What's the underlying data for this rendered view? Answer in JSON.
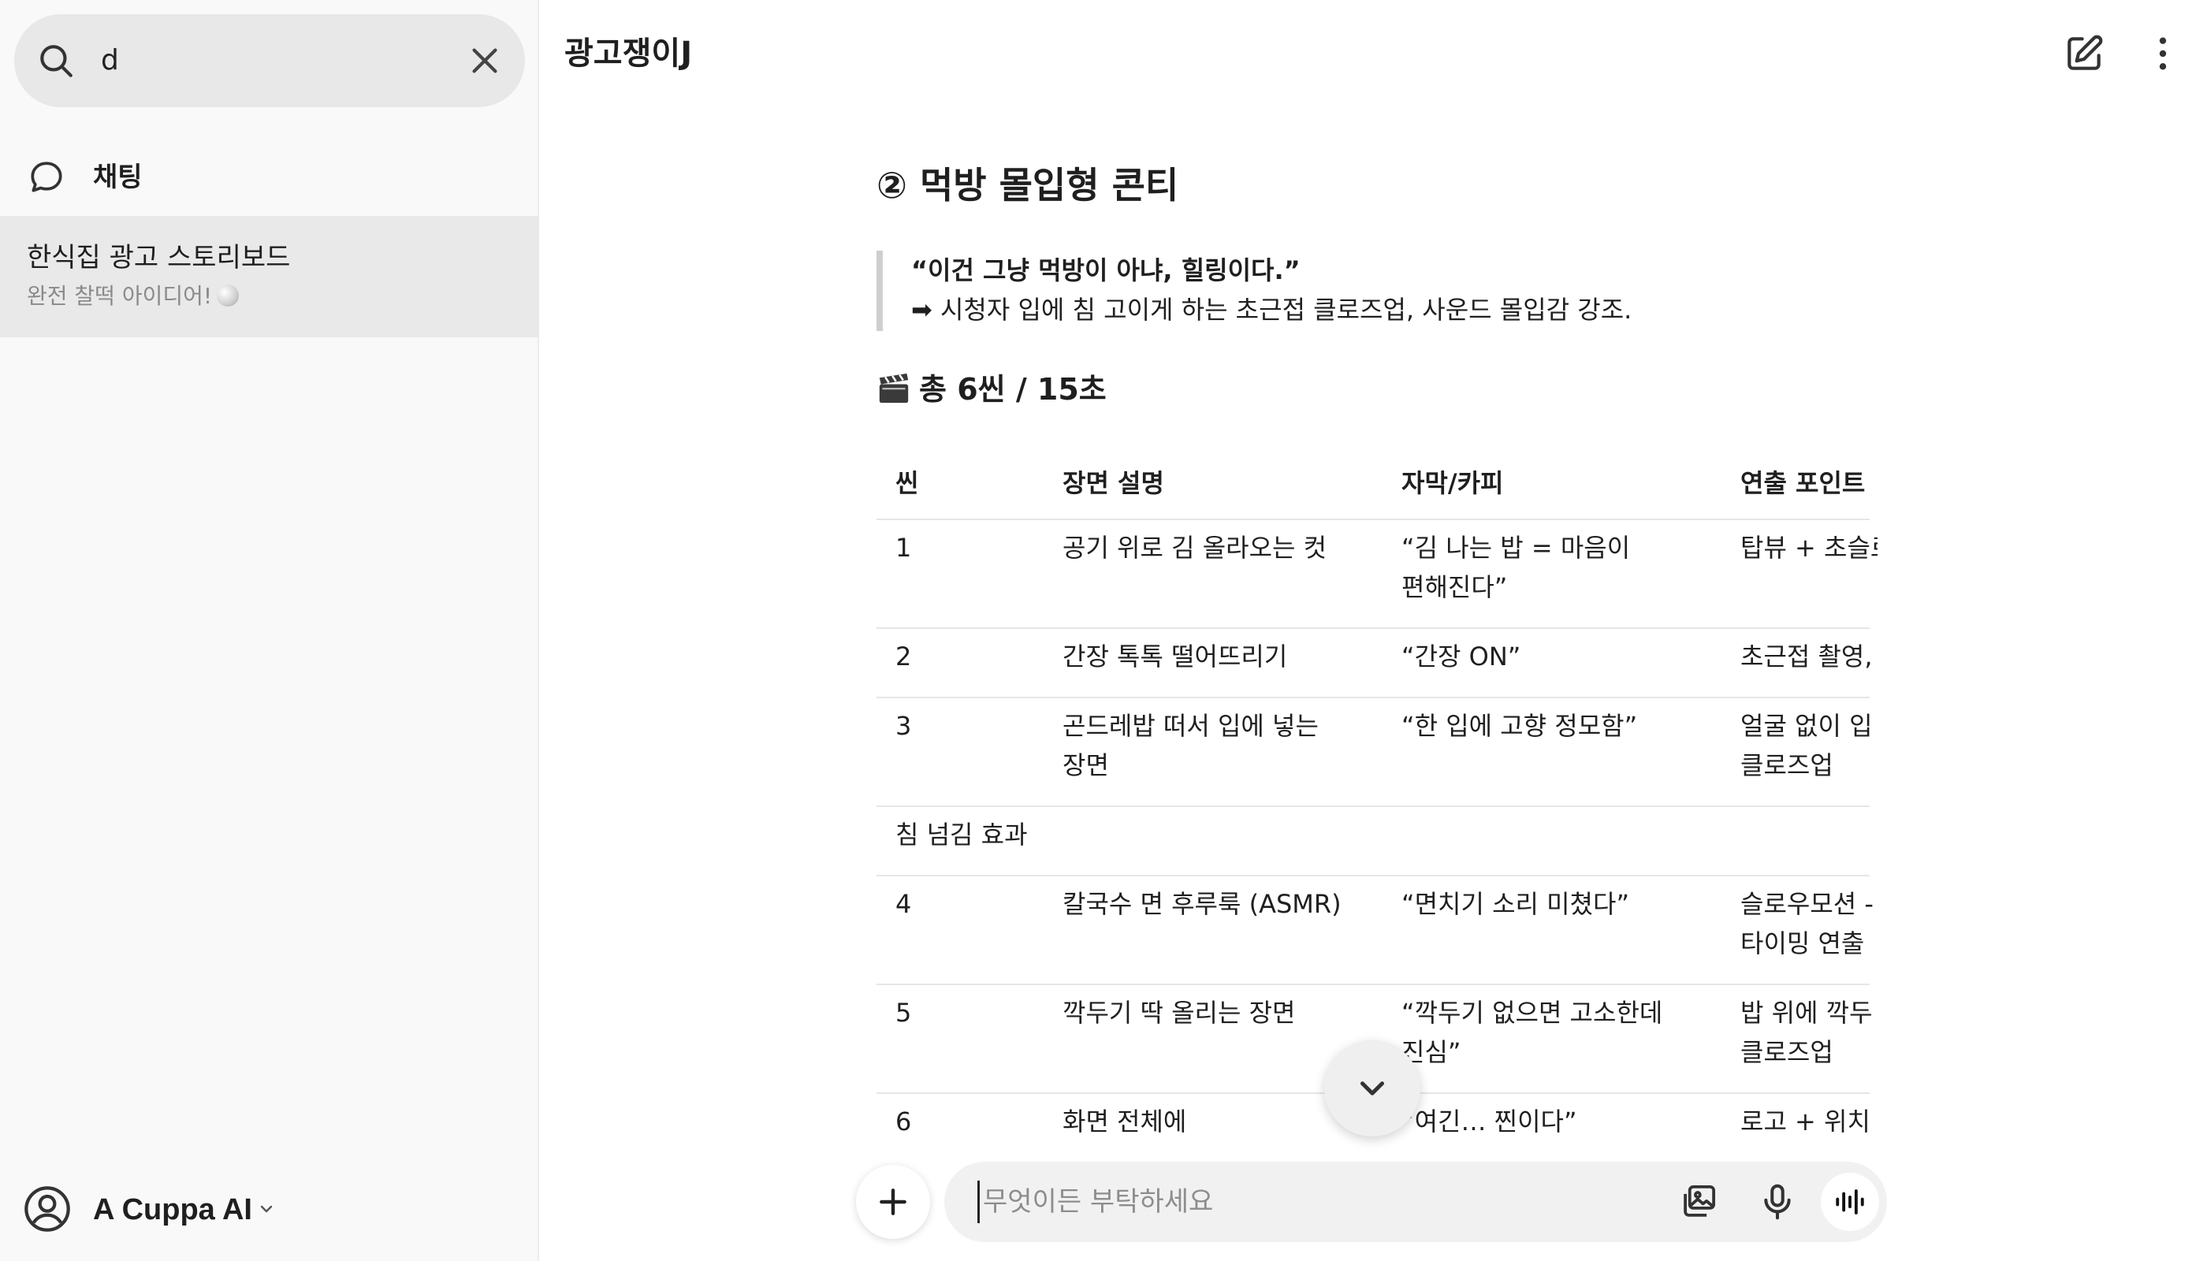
{
  "sidebar": {
    "search": {
      "value": "d"
    },
    "nav_chat_label": "채팅",
    "conversation": {
      "title": "한식집 광고 스토리보드",
      "subtitle": "완전 찰떡 아이디어!"
    },
    "account_name": "A Cuppa AI"
  },
  "header": {
    "title": "광고쟁이J"
  },
  "content": {
    "section_title": "② 먹방 몰입형 콘티",
    "quote_line1": "“이건 그냥 먹방이 아냐, 힐링이다.”",
    "quote_line2": "➡ 시청자 입에 침 고이게 하는 초근접 클로즈업, 사운드 몰입감 강조.",
    "scene_count": "총 6씬 / 15초",
    "table": {
      "headers": [
        "씬",
        "장면 설명",
        "자막/카피",
        "연출 포인트"
      ],
      "rows": [
        {
          "scene": "1",
          "desc1": "공기 위로 김 올라오는 컷",
          "desc2": "",
          "copy1": "“김 나는 밥 = 마음이",
          "copy2": "편해진다”",
          "point1": "탑뷰 + 초슬로",
          "point2": ""
        },
        {
          "scene": "2",
          "desc1": "간장 톡톡 떨어뜨리기",
          "desc2": "",
          "copy1": "“간장 ON”",
          "copy2": "",
          "point1": "초근접 촬영,",
          "point2": ""
        },
        {
          "scene": "3",
          "desc1": "곤드레밥 떠서 입에 넣는",
          "desc2": "장면",
          "copy1": "“한 입에 고향 정모함”",
          "copy2": "",
          "point1": "얼굴 없이 입",
          "point2": "클로즈업"
        },
        {
          "scene": "침 넘김 효과",
          "desc1": "",
          "desc2": "",
          "copy1": "",
          "copy2": "",
          "point1": "",
          "point2": ""
        },
        {
          "scene": "4",
          "desc1": "칼국수 면 후루룩 (ASMR)",
          "desc2": "",
          "copy1": "“면치기 소리 미쳤다”",
          "copy2": "",
          "point1": "슬로우모션 -",
          "point2": "타이밍 연출"
        },
        {
          "scene": "5",
          "desc1": "깍두기 딱 올리는 장면",
          "desc2": "",
          "copy1": "“깍두기 없으면 고소한데",
          "copy2": "진심”",
          "point1": "밥 위에 깍두",
          "point2": "클로즈업"
        },
        {
          "scene": "6",
          "desc1": "화면 전체에",
          "desc2": "",
          "copy1": "“여긴… 찐이다”",
          "copy2": "",
          "point1": "로고 + 위치",
          "point2": ""
        }
      ]
    }
  },
  "composer": {
    "placeholder": "무엇이든 부탁하세요"
  },
  "colors": {
    "sidebar_bg": "#f9f9f9",
    "selected_item_bg": "#e9e9e9",
    "composer_bg": "#f1f1f1",
    "text": "#1f1f1f"
  }
}
